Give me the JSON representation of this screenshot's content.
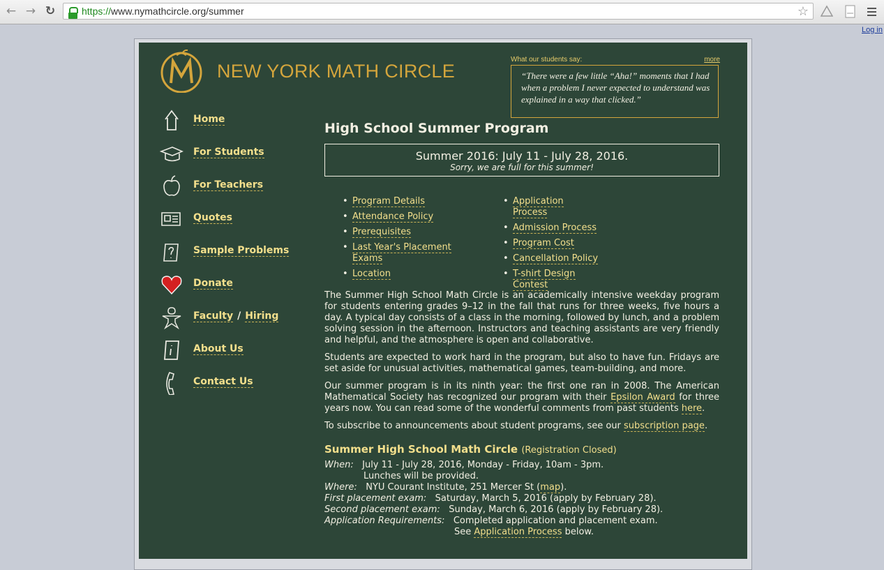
{
  "browser": {
    "url_scheme": "https://",
    "url_rest": "www.nymathcircle.org/summer",
    "login_link": "Log in"
  },
  "site": {
    "brand_name": "NEW YORK MATH CIRCLE",
    "accent_color": "#d4a53c",
    "background_color": "#2d4638"
  },
  "quote": {
    "heading": "What our students say:",
    "more_link": "more",
    "text": "“There were a few little “Aha!” moments that I had when a problem I never expected to understand was explained in a way that clicked.”"
  },
  "sidebar": {
    "items": [
      {
        "label": "Home",
        "icon": "house-icon"
      },
      {
        "label": "For Students",
        "icon": "graduation-cap-icon"
      },
      {
        "label": "For Teachers",
        "icon": "apple-icon"
      },
      {
        "label": "Quotes",
        "icon": "newspaper-icon"
      },
      {
        "label": "Sample Problems",
        "icon": "question-icon"
      },
      {
        "label": "Donate",
        "icon": "heart-icon"
      },
      {
        "label": "Faculty",
        "label2": "Hiring",
        "sep": "/",
        "icon": "person-icon"
      },
      {
        "label": "About Us",
        "icon": "info-icon"
      },
      {
        "label": "Contact Us",
        "icon": "phone-icon"
      }
    ]
  },
  "main": {
    "title": "High School Summer Program",
    "notice_dates": "Summer 2016: July 11 - July 28, 2016.",
    "notice_sorry": "Sorry, we are full for this summer!",
    "links_left": [
      "Program Details",
      "Attendance Policy",
      "Prerequisites",
      "Last Year's Placement Exams",
      "Location"
    ],
    "links_right": [
      "Application Process",
      "Admission Process",
      "Program Cost",
      "Cancellation Policy",
      "T-shirt Design Contest"
    ],
    "para1": "The Summer High School Math Circle is an academically intensive weekday program for students entering grades 9–12 in the fall that runs for three weeks, five hours a day. A typical day consists of a class in the morning, followed by lunch, and a problem solving session in the afternoon. Instructors and teaching assistants are very friendly and helpful, and the atmosphere is open and collaborative.",
    "para2": "Students are expected to work hard in the program, but also to have fun. Fridays are set aside for unusual activities, mathematical games, team-building, and more.",
    "para3_a": "Our summer program is in its ninth year: the first one ran in 2008. The American Mathematical Society has recognized our program with their ",
    "para3_link1": "Epsilon Award",
    "para3_b": " for three years now. You can read some of the wonderful comments from past students ",
    "para3_link2": "here",
    "para3_c": ".",
    "para4_a": "To subscribe to announcements about student programs, see our ",
    "para4_link": "subscription page",
    "para4_b": ".",
    "subheading": "Summer High School Math Circle",
    "subheading_status": "(Registration Closed)",
    "when_label": "When:",
    "when_value": "July 11 - July 28, 2016, Monday - Friday, 10am - 3pm.",
    "when_value2": "Lunches will be provided.",
    "where_label": "Where:",
    "where_value": "NYU Courant Institute, 251 Mercer St (",
    "where_link": "map",
    "where_end": ").",
    "first_label": "First placement exam:",
    "first_value": "Saturday, March 5, 2016 (apply by February 28).",
    "second_label": "Second placement exam:",
    "second_value": "Sunday, March 6, 2016 (apply by February 28).",
    "req_label": "Application Requirements:",
    "req_value": "Completed application and placement exam.",
    "req_see": "See ",
    "req_link": "Application Process",
    "req_end": " below."
  }
}
